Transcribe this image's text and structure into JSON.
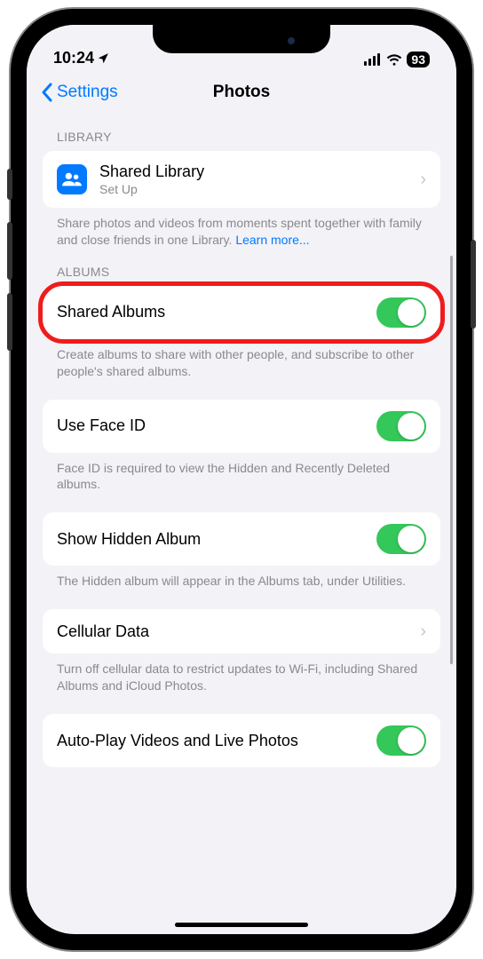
{
  "statusBar": {
    "time": "10:24",
    "battery": "93"
  },
  "nav": {
    "back": "Settings",
    "title": "Photos"
  },
  "library": {
    "header": "LIBRARY",
    "sharedLibrary": {
      "title": "Shared Library",
      "subtitle": "Set Up"
    },
    "footer": "Share photos and videos from moments spent together with family and close friends in one Library.",
    "learnMore": "Learn more..."
  },
  "albums": {
    "header": "ALBUMS",
    "sharedAlbums": {
      "title": "Shared Albums"
    },
    "sharedFooter": "Create albums to share with other people, and subscribe to other people's shared albums.",
    "faceId": {
      "title": "Use Face ID"
    },
    "faceIdFooter": "Face ID is required to view the Hidden and Recently Deleted albums.",
    "hidden": {
      "title": "Show Hidden Album"
    },
    "hiddenFooter": "The Hidden album will appear in the Albums tab, under Utilities.",
    "cellular": {
      "title": "Cellular Data"
    },
    "cellularFooter": "Turn off cellular data to restrict updates to Wi-Fi, including Shared Albums and iCloud Photos.",
    "autoplay": {
      "title": "Auto-Play Videos and Live Photos"
    }
  }
}
